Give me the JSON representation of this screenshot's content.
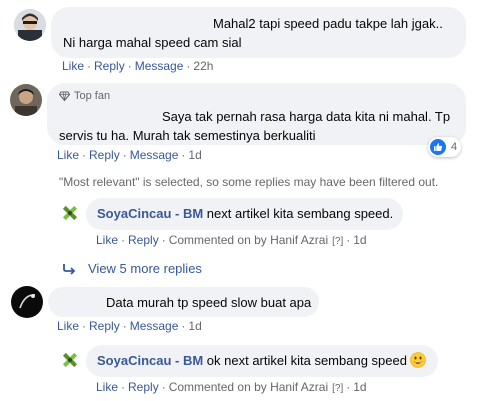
{
  "comments": [
    {
      "text": "Mahal2 tapi speed padu takpe lah jgak.. Ni harga mahal speed cam sial",
      "actions": {
        "like": "Like",
        "reply": "Reply",
        "message": "Message",
        "time": "22h"
      }
    },
    {
      "badge": "Top fan",
      "text": "Saya tak pernah rasa harga data kita ni mahal. Tp servis tu ha. Murah tak semestinya berkualiti",
      "reaction_count": "4",
      "actions": {
        "like": "Like",
        "reply": "Reply",
        "message": "Message",
        "time": "1d"
      }
    },
    {
      "text": "Data murah tp speed slow buat apa",
      "actions": {
        "like": "Like",
        "reply": "Reply",
        "message": "Message",
        "time": "1d"
      }
    }
  ],
  "filter_notice": "\"Most relevant\" is selected, so some replies may have been filtered out.",
  "view_more_replies": "View 5 more replies",
  "replies": [
    {
      "author": "SoyaCincau - BM",
      "text": " next artikel kita sembang speed.",
      "actions": {
        "like": "Like",
        "reply": "Reply",
        "commented_on_by": "Commented on by Hanif Azrai",
        "help": "[?]",
        "time": "1d"
      }
    },
    {
      "author": "SoyaCincau - BM",
      "text": " ok next artikel kita sembang speed",
      "emoji": "grinning-face-emoji",
      "actions": {
        "like": "Like",
        "reply": "Reply",
        "commented_on_by": "Commented on by Hanif Azrai",
        "help": "[?]",
        "time": "1d"
      }
    }
  ],
  "sep": "·",
  "colors": {
    "link": "#385898",
    "muted": "#65676b",
    "bubble": "#f0f2f5",
    "like_blue": "#1877f2",
    "brand_green": "#7ac142"
  }
}
